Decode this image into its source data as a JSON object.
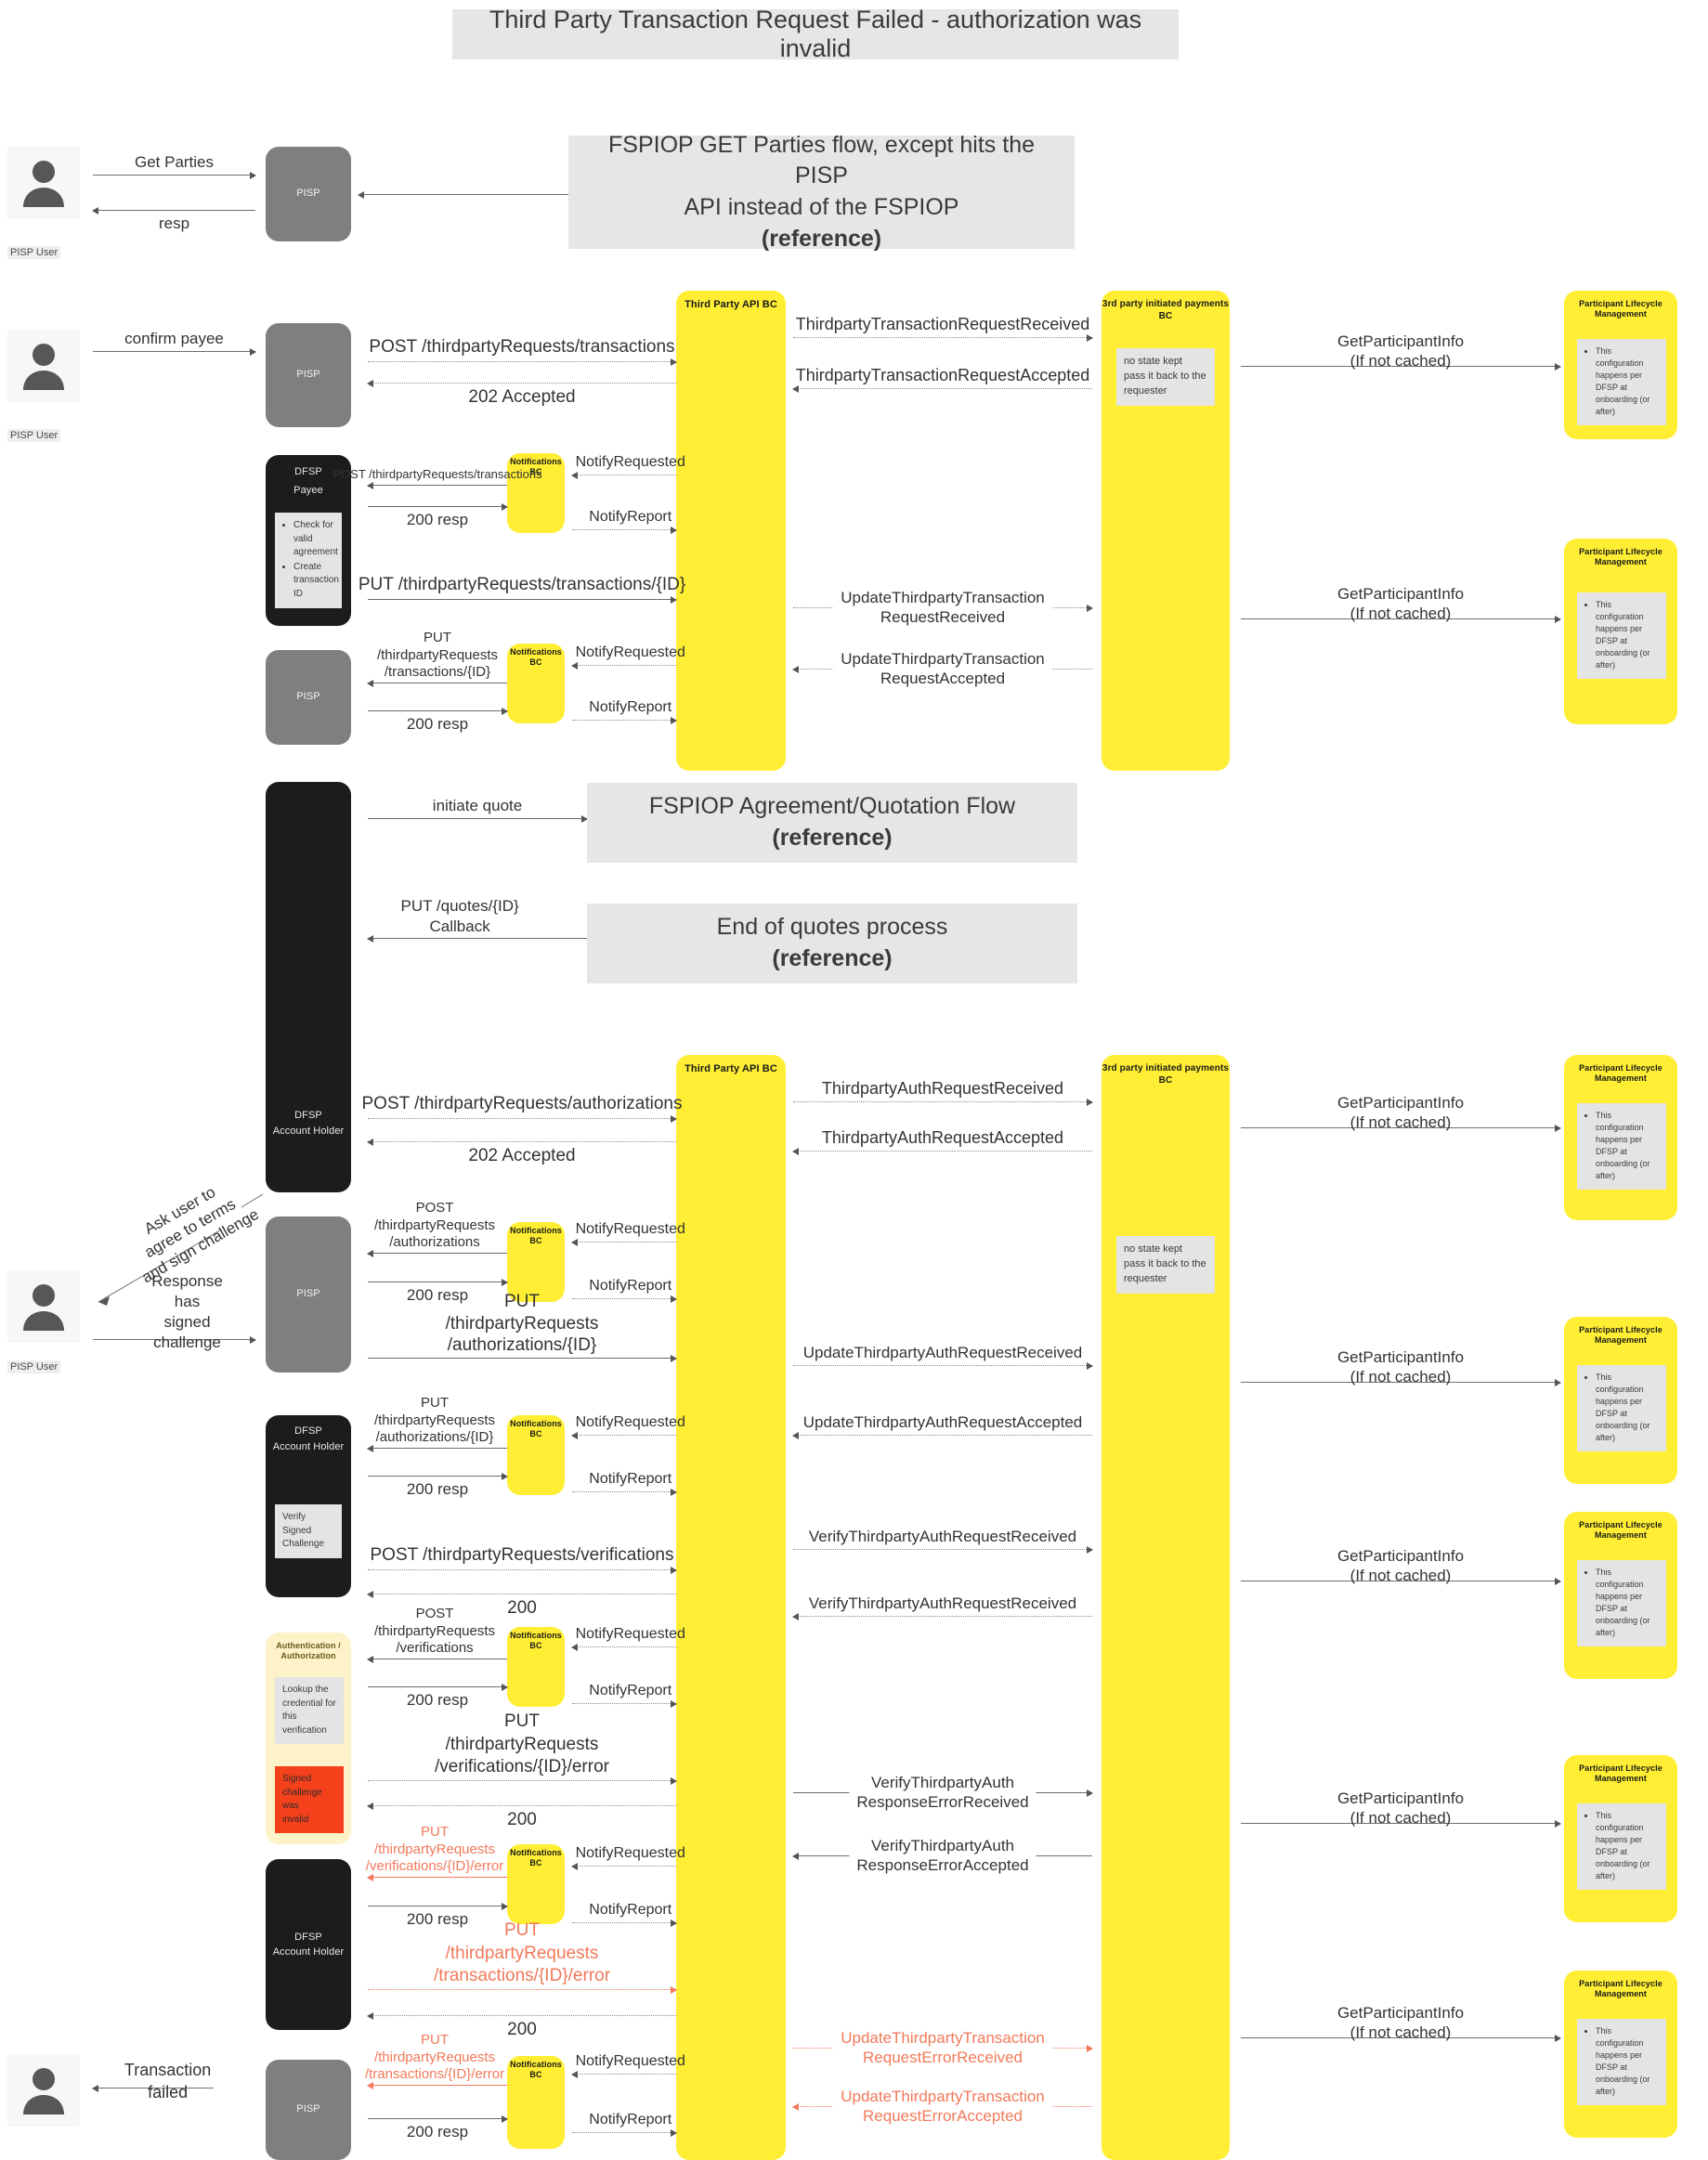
{
  "title": "Third Party Transaction Request Failed - authorization was invalid",
  "actors": {
    "pisp_user": "PISP User",
    "pisp": "PISP",
    "dfsp_payee": "DFSP\nPayee",
    "dfsp_account_holder": "DFSP\nAccount Holder",
    "third_party_api_bc": "Third Party API BC",
    "notifications_bc": "Notifications BC",
    "third_party_payments_bc": "3rd party initiated payments BC",
    "participant_lifecycle": "Participant Lifecycle\nManagement",
    "auth_authz": "Authentication /\nAuthorization"
  },
  "references": {
    "get_parties": {
      "line1": "FSPIOP GET Parties flow, except hits the PISP\nAPI instead of the FSPIOP",
      "line2": "(reference)"
    },
    "quotation": {
      "line1": "FSPIOP Agreement/Quotation Flow",
      "line2": "(reference)"
    },
    "end_quotes": {
      "line1": "End of quotes process",
      "line2": "(reference)"
    }
  },
  "notes": {
    "no_state": "no state kept\npass it back to the\nrequester",
    "plm_config": [
      "This configuration",
      "happens per DFSP",
      "at onboarding (or",
      "after)"
    ],
    "plm_config_text": "This configuration happens per DFSP at onboarding (or after)",
    "dfsp_payee_checks": [
      "Check for valid agreement",
      "Create transaction ID"
    ],
    "verify_signed_challenge": "Verify Signed\nChallenge",
    "lookup_credential": "Lookup the\ncredential for\nthis verification",
    "signed_challenge_invalid": "Signed\nchallenge was\ninvalid"
  },
  "messages": {
    "get_parties": "Get Parties",
    "resp": "resp",
    "confirm_payee": "confirm payee",
    "post_tpr_transactions": "POST /thirdpartyRequests/transactions",
    "accepted_202": "202 Accepted",
    "tptrr": "ThirdpartyTransactionRequestReceived",
    "tptrа": "ThirdpartyTransactionRequestAccepted",
    "get_participant_info": "GetParticipantInfo\n(If not cached)",
    "post_tpr_transactions_small": "POST /thirdpartyRequests/transactions",
    "resp_200": "200 resp",
    "notify_requested": "NotifyRequested",
    "notify_report": "NotifyReport",
    "put_tpr_transactions_id": "PUT /thirdpartyRequests/transactions/{ID}",
    "put_tpr_transactions_id_wrap": "PUT /thirdpartyRequests\n/transactions/{ID}",
    "update_tptr_received": "UpdateThirdpartyTransaction\nRequestReceived",
    "update_tptr_accepted": "UpdateThirdpartyTransaction\nRequestAccepted",
    "initiate_quote": "initiate quote",
    "put_quotes_callback": "PUT /quotes/{ID}\nCallback",
    "post_tpr_authorizations": "POST /thirdpartyRequests/authorizations",
    "tpar_received": "ThirdpartyAuthRequestReceived",
    "tpar_accepted": "ThirdpartyAuthRequestAccepted",
    "post_tpr_authorizations_wrap": "POST /thirdpartyRequests\n/authorizations",
    "put_tpr_authorizations_id_wrap": "PUT /thirdpartyRequests\n/authorizations/{ID}",
    "update_tpar_received": "UpdateThirdpartyAuthRequestReceived",
    "update_tpar_accepted": "UpdateThirdpartyAuthRequestAccepted",
    "ask_user": "Ask user to\nagree to terms\nand sign challenge",
    "response_signed": "Response has\nsigned challenge",
    "post_tpr_verifications": "POST /thirdpartyRequests/verifications",
    "v200": "200",
    "verify_tpar_received": "VerifyThirdpartyAuthRequestReceived",
    "post_tpr_verifications_wrap": "POST /thirdpartyRequests\n/verifications",
    "put_tpr_verifications_error": "PUT /thirdpartyRequests\n/verifications/{ID}/error",
    "verify_tpa_err_received": "VerifyThirdpartyAuth\nResponseErrorReceived",
    "verify_tpa_err_accepted": "VerifyThirdpartyAuth\nResponseErrorAccepted",
    "put_tpr_transactions_error": "PUT /thirdpartyRequests\n/transactions/{ID}/error",
    "update_tptr_err_received": "UpdateThirdpartyTransaction\nRequestErrorReceived",
    "update_tptr_err_accepted": "UpdateThirdpartyTransaction\nRequestErrorAccepted",
    "transaction_failed": "Transaction\nfailed"
  },
  "colors": {
    "yellow": "#ffee33",
    "cream": "#fdf2c8",
    "grey": "#7f7f7f",
    "black": "#1c1c1c",
    "note_grey": "#e4e4e4",
    "error_red": "#f5411b",
    "error_text": "#f2795a",
    "banner_grey": "#e6e6e6"
  }
}
